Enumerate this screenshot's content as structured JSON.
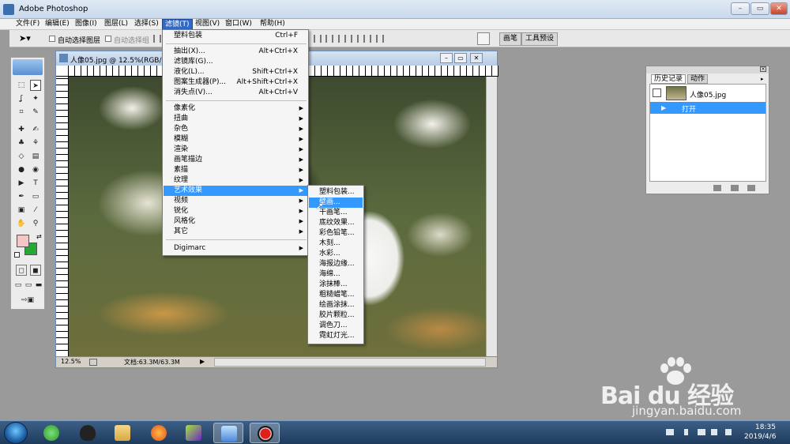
{
  "app": {
    "title": "Adobe Photoshop"
  },
  "window_buttons": {
    "minimize": "–",
    "restore": "▭",
    "close": "✕"
  },
  "menubar": [
    {
      "label": "文件(F)"
    },
    {
      "label": "编辑(E)"
    },
    {
      "label": "图像(I)"
    },
    {
      "label": "图层(L)"
    },
    {
      "label": "选择(S)"
    },
    {
      "label": "滤镜(T)"
    },
    {
      "label": "视图(V)"
    },
    {
      "label": "窗口(W)"
    },
    {
      "label": "帮助(H)"
    }
  ],
  "options_bar": {
    "auto_select_layer": "自动选择图层",
    "auto_select_group": "自动选择组",
    "palette_tabs": [
      "画笔",
      "工具预设"
    ]
  },
  "document": {
    "title": "人像05.jpg @ 12.5%(RGB/8",
    "zoom": "12.5%",
    "doc_info": "文档:63.3M/63.3M"
  },
  "filter_menu": {
    "top_items": [
      {
        "label": "塑料包装",
        "shortcut": "Ctrl+F"
      }
    ],
    "group1": [
      {
        "label": "抽出(X)...",
        "shortcut": "Alt+Ctrl+X"
      },
      {
        "label": "滤镜库(G)...",
        "shortcut": ""
      },
      {
        "label": "液化(L)...",
        "shortcut": "Shift+Ctrl+X"
      },
      {
        "label": "图案生成器(P)...",
        "shortcut": "Alt+Shift+Ctrl+X"
      },
      {
        "label": "消失点(V)...",
        "shortcut": "Alt+Ctrl+V"
      }
    ],
    "group2": [
      {
        "label": "像素化"
      },
      {
        "label": "扭曲"
      },
      {
        "label": "杂色"
      },
      {
        "label": "模糊"
      },
      {
        "label": "渲染"
      },
      {
        "label": "画笔描边"
      },
      {
        "label": "素描"
      },
      {
        "label": "纹理"
      },
      {
        "label": "艺术效果"
      },
      {
        "label": "视频"
      },
      {
        "label": "锐化"
      },
      {
        "label": "风格化"
      },
      {
        "label": "其它"
      }
    ],
    "group3": [
      {
        "label": "Digimarc"
      }
    ],
    "highlighted": "艺术效果"
  },
  "artistic_submenu": {
    "items": [
      "塑料包装...",
      "壁画...",
      "干画笔...",
      "底纹效果...",
      "彩色铅笔...",
      "木刻...",
      "水彩...",
      "海报边缘...",
      "海绵...",
      "涂抹棒...",
      "粗糙蜡笔...",
      "绘画涂抹...",
      "胶片颗粒...",
      "调色刀...",
      "霓虹灯光..."
    ],
    "highlighted": "壁画..."
  },
  "history_panel": {
    "tabs": [
      "历史记录",
      "动作"
    ],
    "snapshot": "人像05.jpg",
    "steps": [
      "打开"
    ]
  },
  "taskbar": {
    "time": "18:35",
    "date": "2019/4/6"
  },
  "watermark": {
    "logo": "Bai du 经验",
    "url": "jingyan.baidu.com"
  }
}
